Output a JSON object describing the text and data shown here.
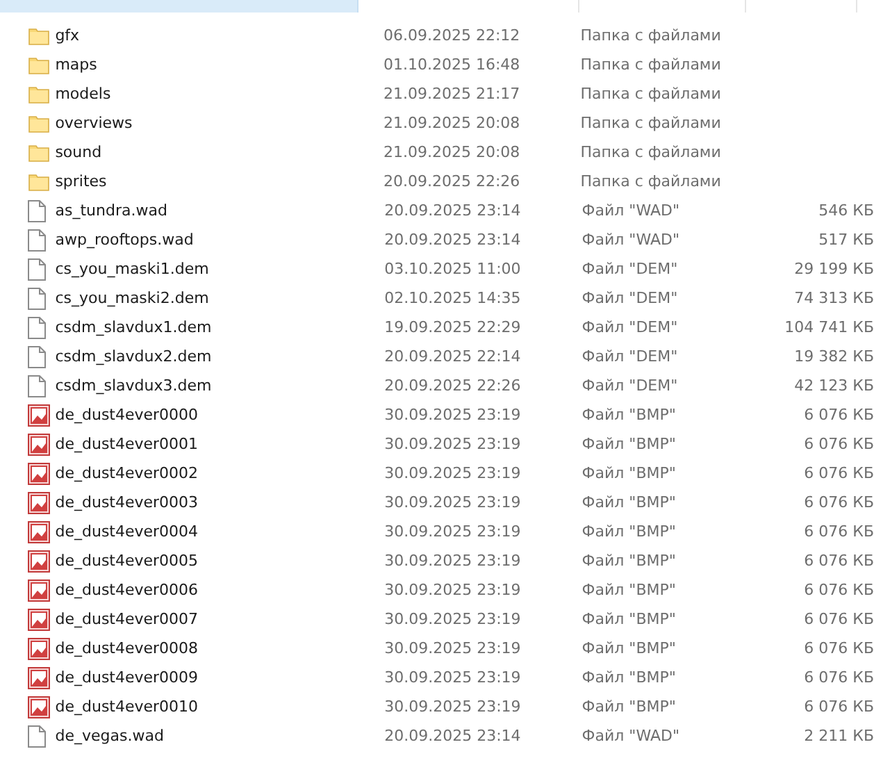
{
  "header": {
    "columns": [
      {
        "selected": true
      },
      {
        "selected": false
      },
      {
        "selected": false
      },
      {
        "selected": false
      }
    ]
  },
  "rows": [
    {
      "kind": "folder",
      "name": "gfx",
      "date": "06.09.2025 22:12",
      "type": "Папка с файлами"
    },
    {
      "kind": "folder",
      "name": "maps",
      "date": "01.10.2025 16:48",
      "type": "Папка с файлами"
    },
    {
      "kind": "folder",
      "name": "models",
      "date": "21.09.2025 21:17",
      "type": "Папка с файлами"
    },
    {
      "kind": "folder",
      "name": "overviews",
      "date": "21.09.2025 20:08",
      "type": "Папка с файлами"
    },
    {
      "kind": "folder",
      "name": "sound",
      "date": "21.09.2025 20:08",
      "type": "Папка с файлами"
    },
    {
      "kind": "folder",
      "name": "sprites",
      "date": "20.09.2025 22:26",
      "type": "Папка с файлами"
    },
    {
      "kind": "file",
      "name": "as_tundra.wad",
      "date": "20.09.2025 23:14",
      "type": "Файл \"WAD\"",
      "size": "546 КБ"
    },
    {
      "kind": "file",
      "name": "awp_rooftops.wad",
      "date": "20.09.2025 23:14",
      "type": "Файл \"WAD\"",
      "size": "517 КБ"
    },
    {
      "kind": "file",
      "name": "cs_you_maski1.dem",
      "date": "03.10.2025 11:00",
      "type": "Файл \"DEM\"",
      "size": "29 199 КБ"
    },
    {
      "kind": "file",
      "name": "cs_you_maski2.dem",
      "date": "02.10.2025 14:35",
      "type": "Файл \"DEM\"",
      "size": "74 313 КБ"
    },
    {
      "kind": "file",
      "name": "csdm_slavdux1.dem",
      "date": "19.09.2025 22:29",
      "type": "Файл \"DEM\"",
      "size": "104 741 КБ"
    },
    {
      "kind": "file",
      "name": "csdm_slavdux2.dem",
      "date": "20.09.2025 22:14",
      "type": "Файл \"DEM\"",
      "size": "19 382 КБ"
    },
    {
      "kind": "file",
      "name": "csdm_slavdux3.dem",
      "date": "20.09.2025 22:26",
      "type": "Файл \"DEM\"",
      "size": "42 123 КБ"
    },
    {
      "kind": "image",
      "name": "de_dust4ever0000",
      "date": "30.09.2025 23:19",
      "type": "Файл \"BMP\"",
      "size": "6 076 КБ"
    },
    {
      "kind": "image",
      "name": "de_dust4ever0001",
      "date": "30.09.2025 23:19",
      "type": "Файл \"BMP\"",
      "size": "6 076 КБ"
    },
    {
      "kind": "image",
      "name": "de_dust4ever0002",
      "date": "30.09.2025 23:19",
      "type": "Файл \"BMP\"",
      "size": "6 076 КБ"
    },
    {
      "kind": "image",
      "name": "de_dust4ever0003",
      "date": "30.09.2025 23:19",
      "type": "Файл \"BMP\"",
      "size": "6 076 КБ"
    },
    {
      "kind": "image",
      "name": "de_dust4ever0004",
      "date": "30.09.2025 23:19",
      "type": "Файл \"BMP\"",
      "size": "6 076 КБ"
    },
    {
      "kind": "image",
      "name": "de_dust4ever0005",
      "date": "30.09.2025 23:19",
      "type": "Файл \"BMP\"",
      "size": "6 076 КБ"
    },
    {
      "kind": "image",
      "name": "de_dust4ever0006",
      "date": "30.09.2025 23:19",
      "type": "Файл \"BMP\"",
      "size": "6 076 КБ"
    },
    {
      "kind": "image",
      "name": "de_dust4ever0007",
      "date": "30.09.2025 23:19",
      "type": "Файл \"BMP\"",
      "size": "6 076 КБ"
    },
    {
      "kind": "image",
      "name": "de_dust4ever0008",
      "date": "30.09.2025 23:19",
      "type": "Файл \"BMP\"",
      "size": "6 076 КБ"
    },
    {
      "kind": "image",
      "name": "de_dust4ever0009",
      "date": "30.09.2025 23:19",
      "type": "Файл \"BMP\"",
      "size": "6 076 КБ"
    },
    {
      "kind": "image",
      "name": "de_dust4ever0010",
      "date": "30.09.2025 23:19",
      "type": "Файл \"BMP\"",
      "size": "6 076 КБ"
    },
    {
      "kind": "file",
      "name": "de_vegas.wad",
      "date": "20.09.2025 23:14",
      "type": "Файл \"WAD\"",
      "size": "2 211 КБ"
    }
  ]
}
